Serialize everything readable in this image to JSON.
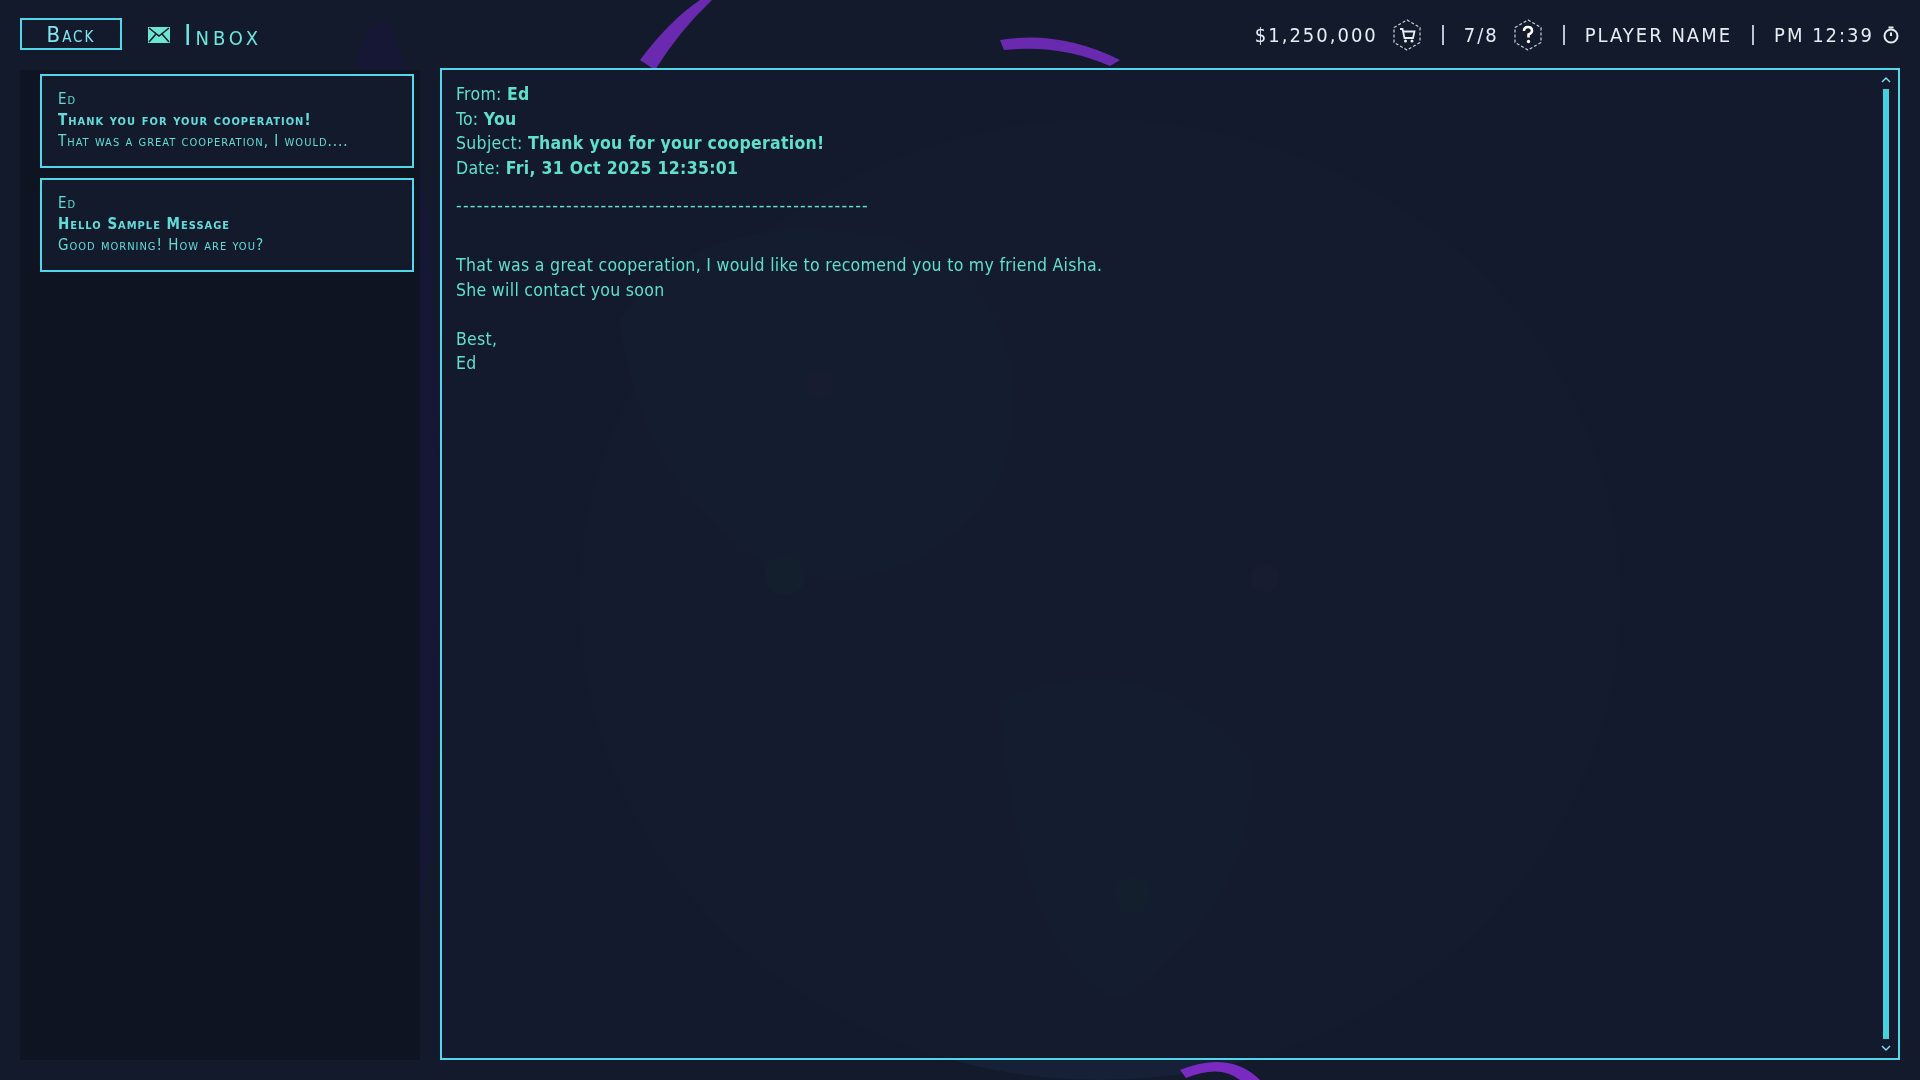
{
  "header": {
    "back_button": "Back",
    "title": "Inbox",
    "money": "$1,250,000",
    "progress": "7/8",
    "player": "PLAYER NAME",
    "time": "PM 12:39"
  },
  "messages": [
    {
      "sender": "Ed",
      "subject": "Thank you for your cooperation!",
      "preview": "That was a great cooperation, I would...."
    },
    {
      "sender": "Ed",
      "subject": "Hello Sample Message",
      "preview": "Good morning! How are you?"
    }
  ],
  "email": {
    "fields": [
      {
        "label": "From:",
        "value": "Ed"
      },
      {
        "label": "To:",
        "value": "You"
      },
      {
        "label": "Subject:",
        "value": "Thank you for your cooperation!"
      },
      {
        "label": "Date:",
        "value": "Fri, 31 Oct 2025 12:35:01"
      }
    ],
    "separator": "------------------------------------------------------------",
    "paragraphs": [
      {
        "lines": [
          "That was a great cooperation, I would like to recomend you to my friend Aisha.",
          "She will contact you soon"
        ]
      },
      {
        "lines": [
          "Best,",
          "Ed"
        ]
      }
    ]
  }
}
